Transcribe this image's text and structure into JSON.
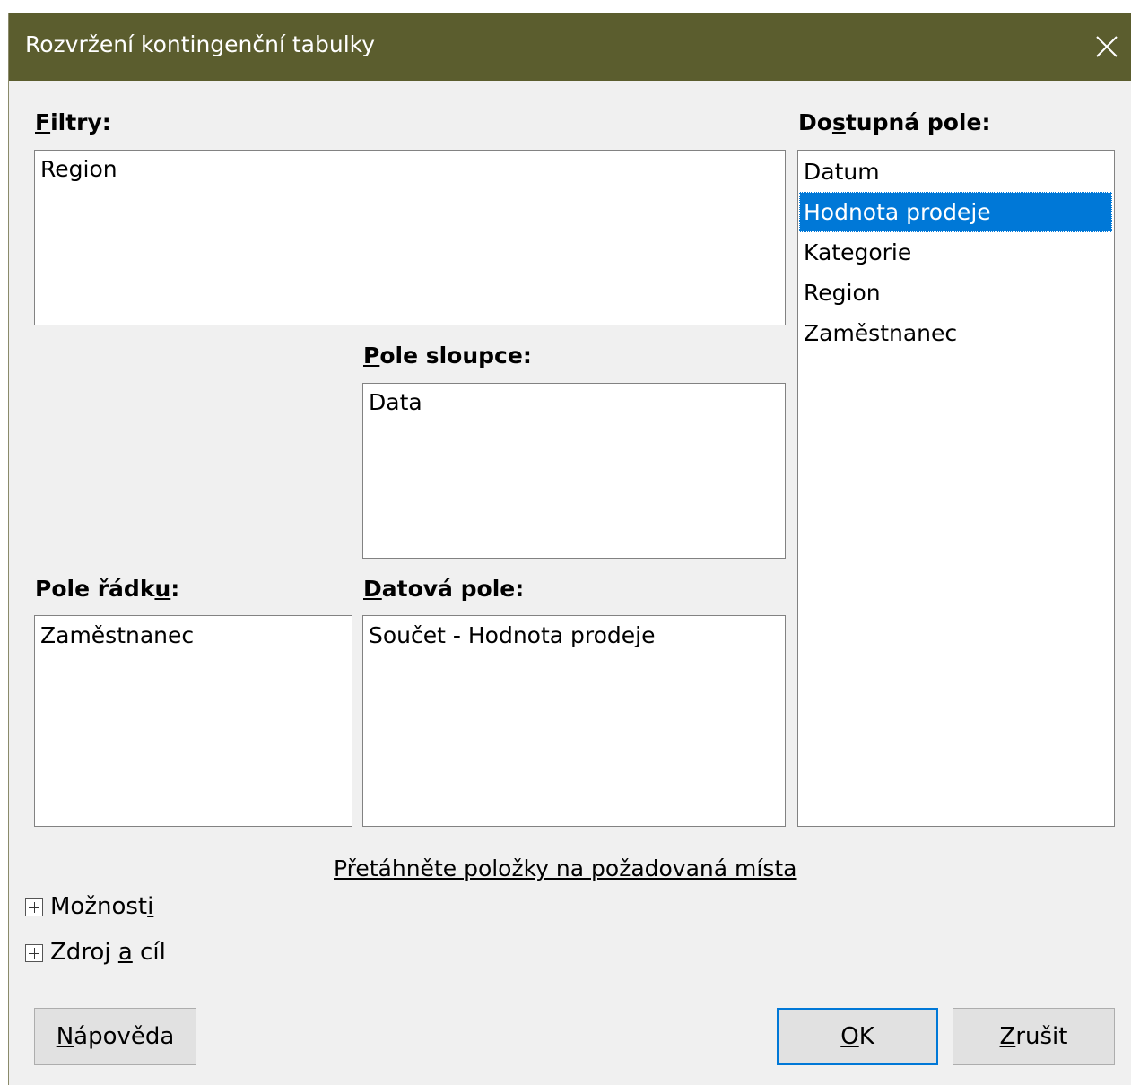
{
  "dialog": {
    "title": "Rozvržení kontingenční tabulky"
  },
  "filters": {
    "label_u": "F",
    "label_rest": "iltry:",
    "items": [
      "Region"
    ]
  },
  "column_fields": {
    "label_u": "P",
    "label_rest": "ole sloupce:",
    "items": [
      "Data"
    ]
  },
  "row_fields": {
    "label_pre": "Pole řádk",
    "label_u": "u",
    "label_post": ":",
    "items": [
      "Zaměstnanec"
    ]
  },
  "data_fields": {
    "label_u": "D",
    "label_rest": "atová pole:",
    "items": [
      "Součet - Hodnota prodeje"
    ]
  },
  "available_fields": {
    "label_pre": "Do",
    "label_u": "s",
    "label_post": "tupná pole:",
    "items": [
      "Datum",
      "Hodnota prodeje",
      "Kategorie",
      "Region",
      "Zaměstnanec"
    ],
    "selected": "Hodnota prodeje"
  },
  "hint": "Přetáhněte položky na požadovaná místa",
  "options_expander": {
    "label_pre": "Možnost",
    "label_u": "i",
    "label_post": ""
  },
  "source_expander": {
    "label_pre": "Zdroj ",
    "label_u": "a",
    "label_post": " cíl"
  },
  "buttons": {
    "help_u": "N",
    "help_rest": "ápověda",
    "ok_u": "O",
    "ok_rest": "K",
    "cancel_u": "Z",
    "cancel_rest": "rušit"
  },
  "colors": {
    "titlebar": "#5b5d2e",
    "selection": "#0078d7",
    "default_button_border": "#0078d7"
  }
}
